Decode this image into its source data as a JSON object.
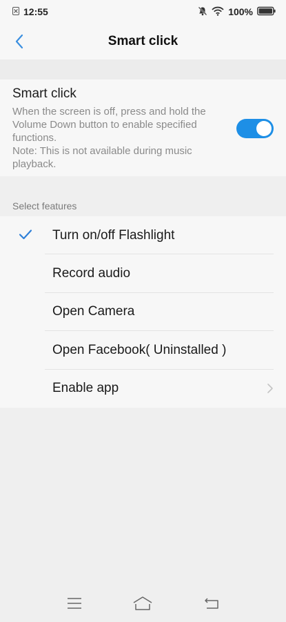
{
  "status": {
    "time": "12:55",
    "battery": "100%",
    "icons": [
      "notification-icon",
      "mute-icon",
      "wifi-icon",
      "battery-icon"
    ]
  },
  "header": {
    "title": "Smart click"
  },
  "smart_click": {
    "title": "Smart click",
    "description": "When the screen is off, press and hold the Volume Down button to enable specified functions.",
    "note": "Note: This is not available during music playback.",
    "enabled": true
  },
  "features": {
    "section_label": "Select features",
    "items": [
      {
        "label": "Turn on/off Flashlight",
        "selected": true
      },
      {
        "label": "Record audio",
        "selected": false
      },
      {
        "label": "Open Camera",
        "selected": false
      },
      {
        "label": "Open Facebook( Uninstalled )",
        "selected": false
      },
      {
        "label": "Enable app",
        "selected": false
      }
    ]
  },
  "colors": {
    "accent": "#1e8fe6",
    "background": "#efefef",
    "surface": "#f7f7f7"
  }
}
